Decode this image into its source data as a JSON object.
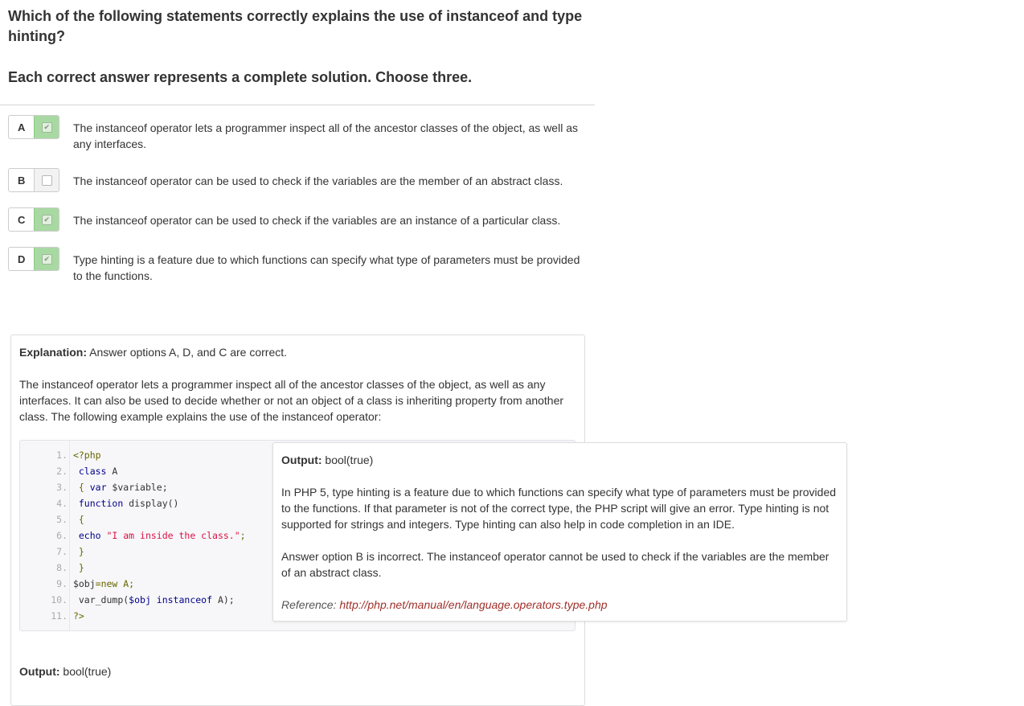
{
  "question": "Which of the following statements correctly explains the use of instanceof and type hinting?",
  "instruction": "Each correct answer represents a complete solution. Choose three.",
  "options": [
    {
      "letter": "A",
      "checked": true,
      "text": "The instanceof operator lets a programmer inspect all of the ancestor classes of the object, as well as any interfaces."
    },
    {
      "letter": "B",
      "checked": false,
      "text": "The instanceof operator can be used to check if the variables are the member of an abstract class."
    },
    {
      "letter": "C",
      "checked": true,
      "text": "The instanceof operator can be used to check if the variables are an instance of a particular class."
    },
    {
      "letter": "D",
      "checked": true,
      "text": "Type hinting is a feature due to which functions can specify what type of parameters must be provided to the functions."
    }
  ],
  "explanation": {
    "label": "Explanation:",
    "summary": "Answer options A, D, and C are correct.",
    "paragraph1": "The instanceof operator lets a programmer inspect all of the ancestor classes of the object, as well as any interfaces. It can also be used to decide whether or not an object of a class is inheriting property from another class. The following example explains the use of the instanceof operator:",
    "code_line_numbers": [
      "1.",
      "2.",
      "3.",
      "4.",
      "5.",
      "6.",
      "7.",
      "8.",
      "9.",
      "10.",
      "11."
    ],
    "code": {
      "l1": "<?php",
      "l2_kw": "class",
      "l2_rest": " A",
      "l3_pun": "{",
      "l3_kw": " var",
      "l3_rest": " $variable;",
      "l4_kw": "function",
      "l4_rest": " display()",
      "l5": "{",
      "l6_kw": "echo",
      "l6_str": " \"I am inside the class.\"",
      "l6_end": ";",
      "l7": "}",
      "l8": "}",
      "l9_a": "$obj",
      "l9_b": "=new A;",
      "l10_a": "var_dump(",
      "l10_b": "$obj instanceof",
      "l10_c": " A);",
      "l11": "?>"
    },
    "output_label": "Output:",
    "output_value": "bool(true)"
  },
  "popup": {
    "output_label": "Output:",
    "output_value": "bool(true)",
    "paragraph1": "In PHP 5, type hinting is a feature due to which functions can specify what type of parameters must be provided to the functions. If that parameter is not of the correct type, the PHP script will give an error. Type hinting is not supported for strings and integers. Type hinting can also help in code completion in an IDE.",
    "paragraph2": "Answer option B is incorrect. The instanceof operator cannot be used to check if the variables are the member of an abstract class.",
    "reference_label": "Reference:",
    "reference_url": "http://php.net/manual/en/language.operators.type.php"
  },
  "colors": {
    "checked_bg": "#a9d9a2",
    "unchecked_bg": "#f2f2f2",
    "link": "#a0302a",
    "code_keyword": "#000088",
    "code_string": "#dd1144"
  },
  "icons": {
    "checked": "check-icon",
    "unchecked": "empty-checkbox-icon"
  }
}
